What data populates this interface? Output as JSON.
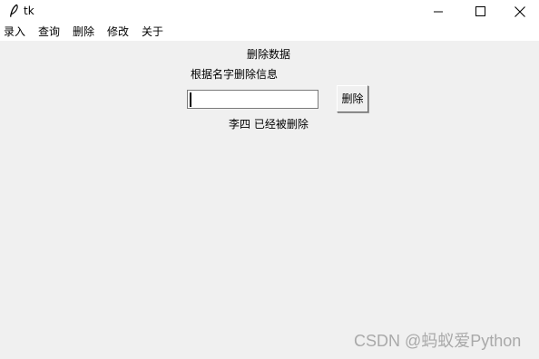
{
  "window": {
    "title": "tk",
    "icon": "feather-icon",
    "controls": [
      "minimize-icon",
      "maximize-icon",
      "close-icon"
    ]
  },
  "menu": {
    "items": [
      {
        "label": "录入"
      },
      {
        "label": "查询"
      },
      {
        "label": "删除"
      },
      {
        "label": "修改"
      },
      {
        "label": "关于"
      }
    ]
  },
  "form": {
    "heading": "删除数据",
    "instruction": "根据名字删除信息",
    "name_input_value": "",
    "delete_label": "删除",
    "result_message": "李四 已经被删除"
  },
  "watermark": "CSDN @蚂蚁爱Python"
}
